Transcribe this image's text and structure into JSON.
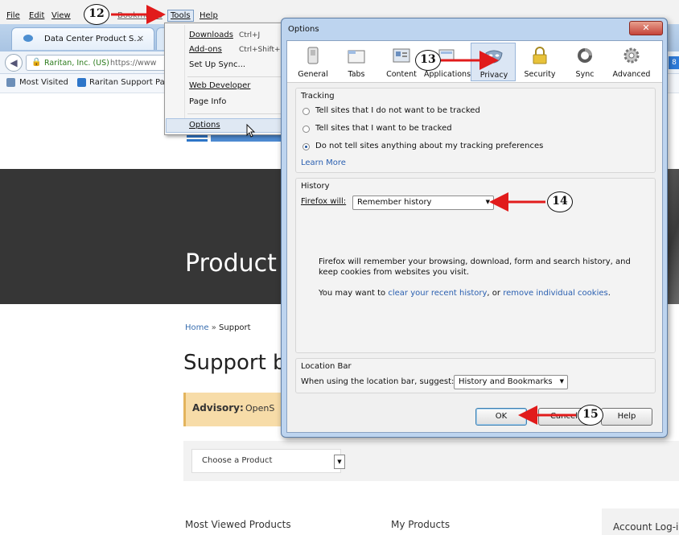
{
  "menubar": {
    "items": [
      "File",
      "Edit",
      "View",
      "Bookmarks",
      "Tools",
      "Help"
    ]
  },
  "tab": {
    "title": "Data Center Product S...",
    "close": "×"
  },
  "urlbar": {
    "site": "Raritan, Inc. (US)",
    "path": "https://www"
  },
  "bookmarks": {
    "most_visited": "Most Visited",
    "raritan_support": "Raritan Support Pag"
  },
  "tools_menu": {
    "items": [
      {
        "label": "Downloads",
        "shortcut": "Ctrl+J"
      },
      {
        "label": "Add-ons",
        "shortcut": "Ctrl+Shift+"
      },
      {
        "label": "Set Up Sync...",
        "shortcut": ""
      },
      {
        "label": "Web Developer",
        "shortcut": ""
      },
      {
        "label": "Page Info",
        "shortcut": ""
      },
      {
        "label": "Options",
        "shortcut": ""
      }
    ]
  },
  "page": {
    "hero_title": "Product",
    "breadcrumb_home": "Home",
    "breadcrumb_sep": "»",
    "breadcrumb_current": "Support",
    "support_title": "Support b",
    "advisory_label": "Advisory:",
    "advisory_text": "OpenS",
    "choose_product": "Choose a Product",
    "most_viewed": "Most Viewed Products",
    "my_products": "My Products",
    "account_login": "Account Log-i"
  },
  "dialog": {
    "title": "Options",
    "tabs": [
      "General",
      "Tabs",
      "Content",
      "Applications",
      "Privacy",
      "Security",
      "Sync",
      "Advanced"
    ],
    "selected_tab": "Privacy",
    "tracking": {
      "heading": "Tracking",
      "options": [
        "Tell sites that I do not want to be tracked",
        "Tell sites that I want to be tracked",
        "Do not tell sites anything about my tracking preferences"
      ],
      "selected": 2,
      "learn_more": "Learn More"
    },
    "history": {
      "heading": "History",
      "firefox_will_label": "Firefox will:",
      "firefox_will_value": "Remember history",
      "description": "Firefox will remember your browsing, download, form and search history, and keep cookies from websites you visit.",
      "clear_prefix": "You may want to",
      "clear_link": "clear your recent history",
      "clear_mid": ", or",
      "remove_link": "remove individual cookies",
      "clear_suffix": "."
    },
    "location_bar": {
      "heading": "Location Bar",
      "label": "When using the location bar, suggest:",
      "value": "History and Bookmarks"
    },
    "buttons": {
      "ok": "OK",
      "cancel": "Cancel",
      "help": "Help"
    }
  },
  "callouts": {
    "c12": "12",
    "c13": "13",
    "c14": "14",
    "c15": "15"
  },
  "colors": {
    "arrow": "#e11b1b",
    "hero_bg": "#363636",
    "advisory_bg": "#f7dca8",
    "dialog_frame": "#bdd4ef"
  }
}
